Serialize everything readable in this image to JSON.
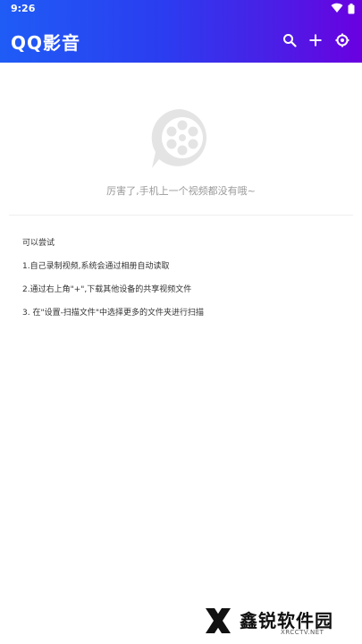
{
  "status_bar": {
    "time": "9:26",
    "wifi_icon": "wifi-icon",
    "battery_icon": "battery-icon"
  },
  "header": {
    "title": "QQ影音",
    "actions": [
      {
        "icon": "search-icon"
      },
      {
        "icon": "add-icon"
      },
      {
        "icon": "settings-icon"
      }
    ],
    "gradient_colors": [
      "#1f5cf6",
      "#6a00e0"
    ]
  },
  "empty_state": {
    "icon": "film-reel-icon",
    "message": "厉害了,手机上一个视频都没有哦~"
  },
  "tips": {
    "heading": "可以尝试",
    "items": [
      "1.自己录制视频,系统会通过相册自动读取",
      "2.通过右上角\"+\",下载其他设备的共享视频文件",
      "3. 在\"设置-扫描文件\"中选择更多的文件夹进行扫描"
    ]
  },
  "watermark": {
    "name": "鑫锐软件园",
    "url": "XRCCTV.NET"
  }
}
